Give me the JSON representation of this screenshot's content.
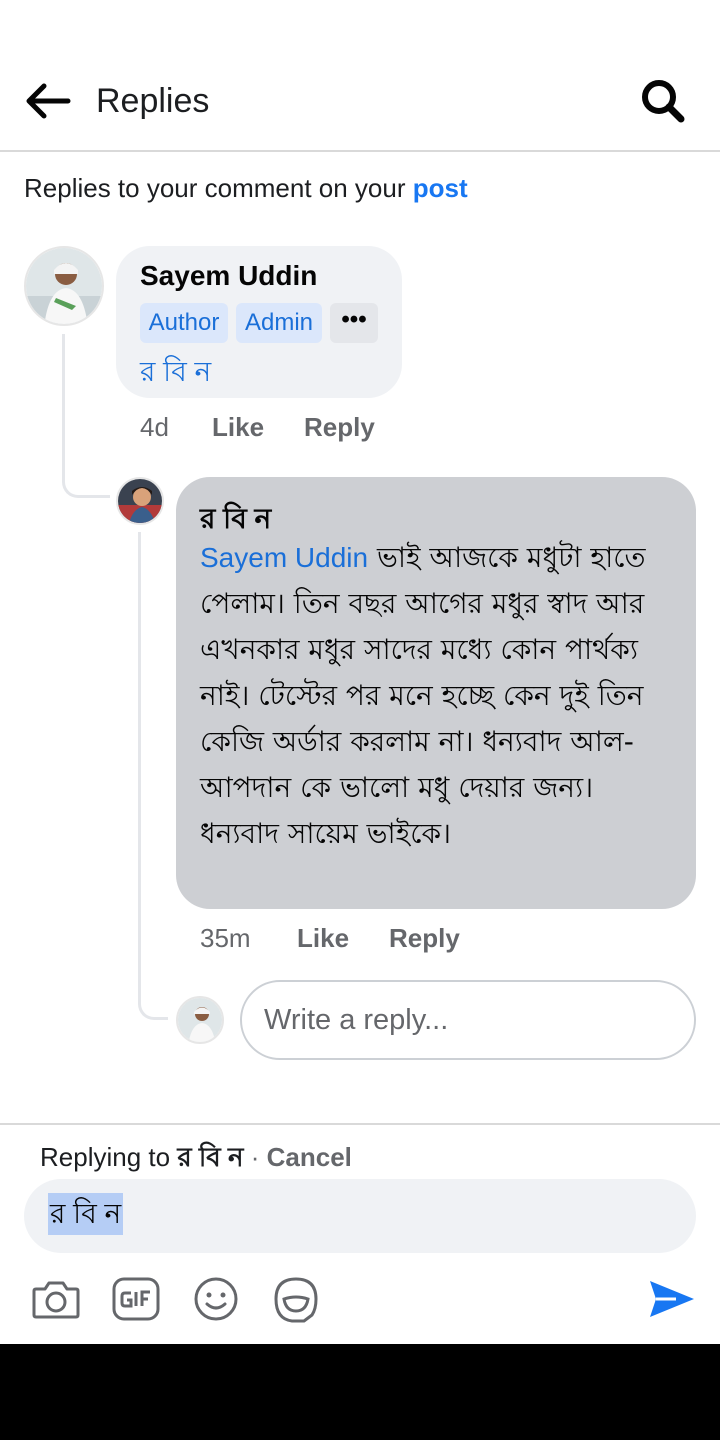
{
  "header": {
    "title": "Replies"
  },
  "context": {
    "prefix": "Replies to your comment on your",
    "link": "post"
  },
  "comment": {
    "author": "Sayem Uddin",
    "badges": [
      "Author",
      "Admin"
    ],
    "more": "•••",
    "mention": "র বি ন",
    "time": "4d",
    "like": "Like",
    "reply": "Reply"
  },
  "reply": {
    "author": "র বি ন",
    "tag": "Sayem Uddin",
    "text": " ভাই আজকে মধুটা হাতে পেলাম। তিন বছর আগের মধুর স্বাদ আর এখনকার মধুর সাদের মধ্যে কোন পার্থক্য নাই। টেস্টের পর মনে হচ্ছে কেন দুই তিন কেজি অর্ডার করলাম না। ধন্যবাদ আল-আপদান কে ভালো মধু দেয়ার জন্য। ধন্যবাদ সায়েম ভাইকে।",
    "time": "35m",
    "like": "Like",
    "reply": "Reply"
  },
  "reply_box": {
    "placeholder": "Write a reply..."
  },
  "composer": {
    "replying_prefix": "Replying to",
    "replying_target": "র বি ন",
    "separator": "·",
    "cancel": "Cancel",
    "input_value": "র বি ন"
  },
  "icons": [
    "back-arrow-icon",
    "search-icon",
    "camera-icon",
    "gif-icon",
    "emoji-icon",
    "sticker-icon",
    "send-icon"
  ],
  "colors": {
    "accent": "#1877f2",
    "badge_bg": "#dbe7fb",
    "bubble": "#f0f2f5",
    "reply_bubble": "#cdcfd3"
  }
}
